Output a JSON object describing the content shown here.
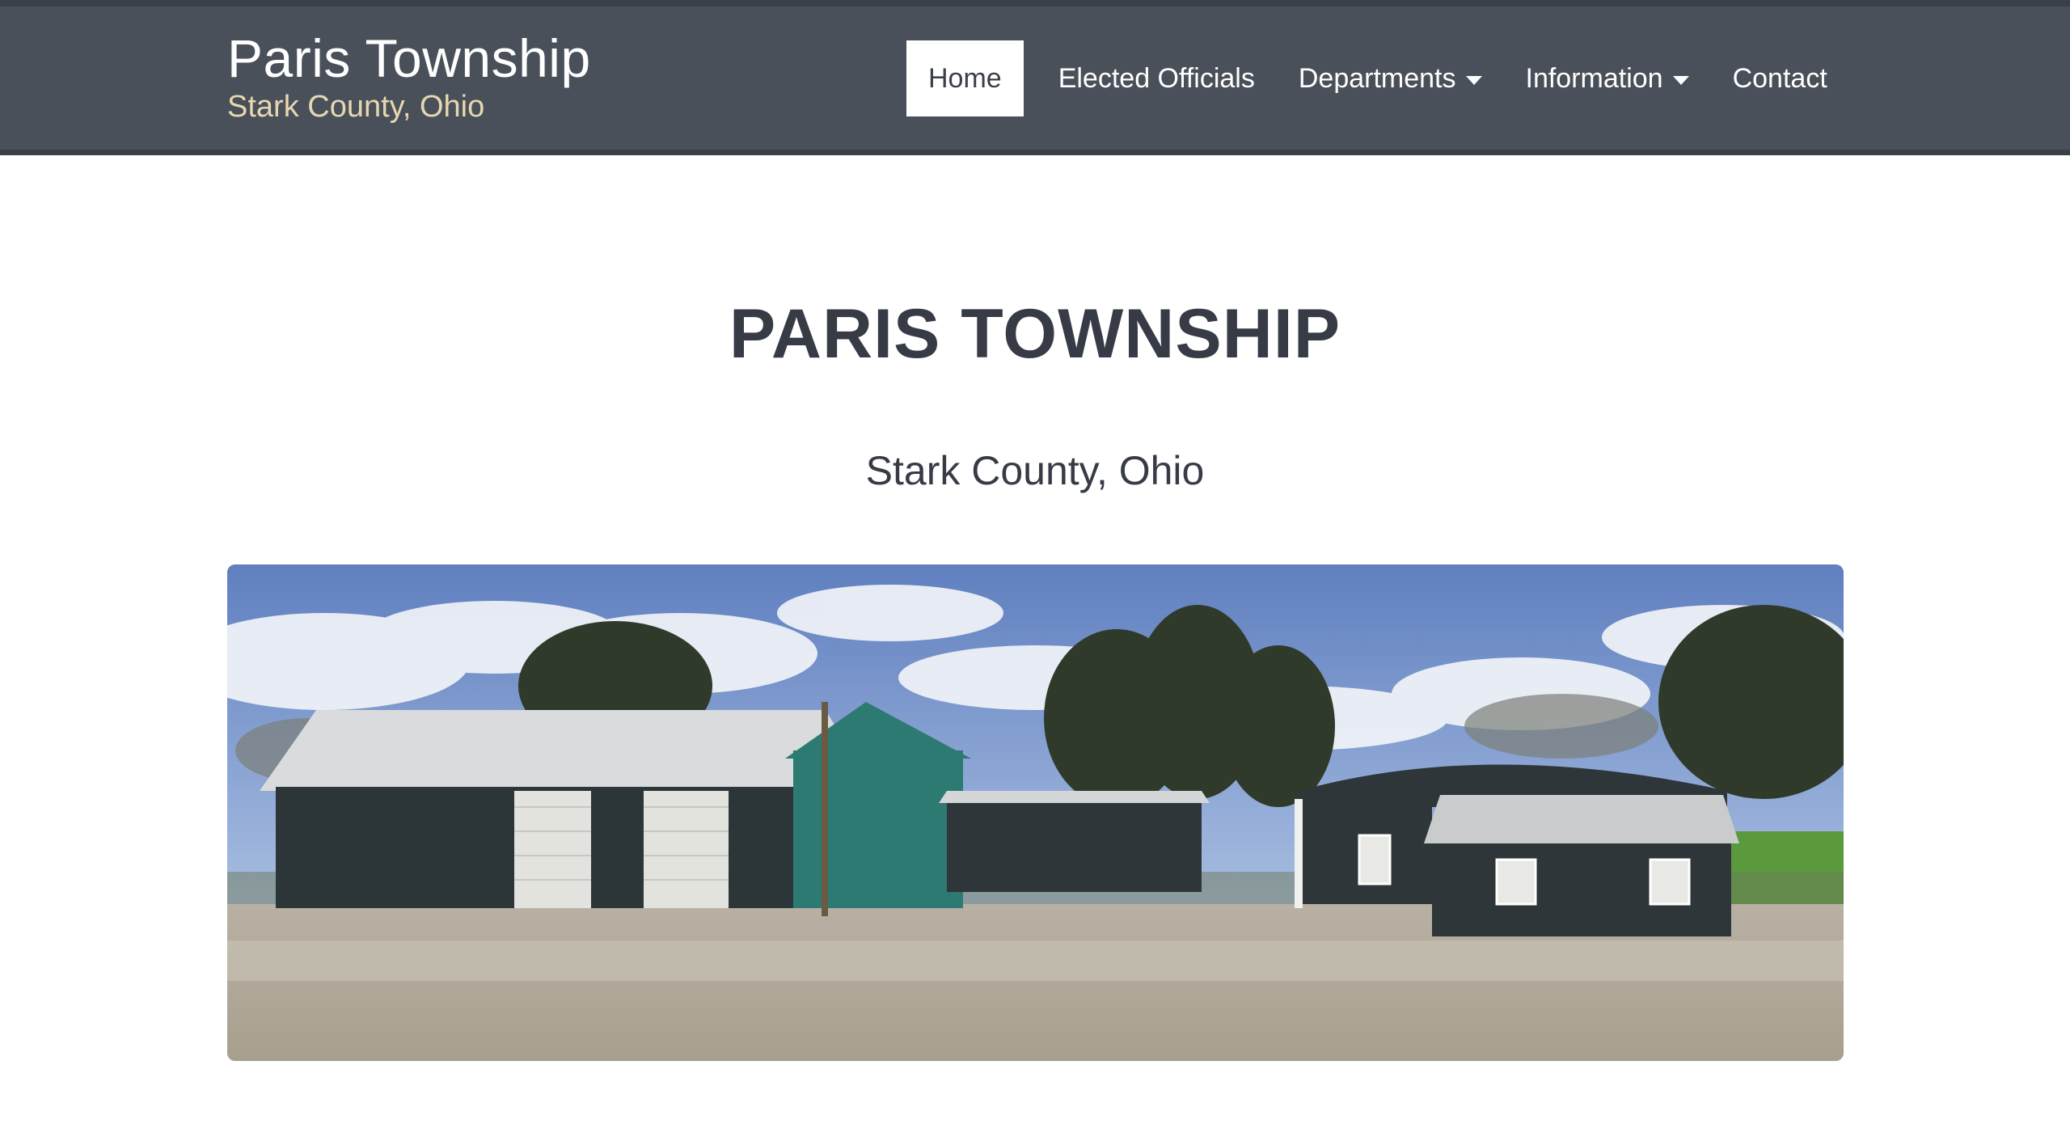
{
  "site": {
    "title": "Paris Township",
    "subtitle": "Stark County, Ohio"
  },
  "nav": {
    "items": [
      {
        "label": "Home",
        "active": true
      },
      {
        "label": "Elected Officials"
      },
      {
        "label": "Departments",
        "dropdown": true
      },
      {
        "label": "Information",
        "dropdown": true
      },
      {
        "label": "Contact"
      }
    ]
  },
  "hero": {
    "title": "PARIS TOWNSHIP",
    "subtitle": "Stark County, Ohio"
  },
  "colors": {
    "header_bg": "#4a5059",
    "header_border": "#3a3f48",
    "subtitle_accent": "#e6d7b2",
    "heading_text": "#363b46"
  },
  "icons": {
    "dropdown": "caret-down-icon"
  }
}
